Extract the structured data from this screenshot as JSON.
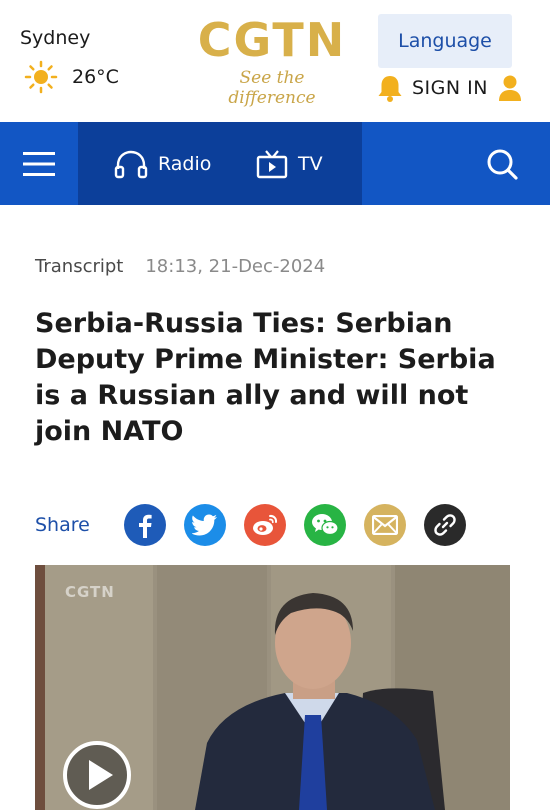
{
  "header": {
    "city": "Sydney",
    "temperature": "26°C",
    "weather_icon": "sun-icon",
    "logo_text": "CGTN",
    "logo_tagline": "See the difference",
    "language_label": "Language",
    "signin_label": "SIGN IN",
    "colors": {
      "gold": "#d8b04a",
      "blue": "#1d4fa8"
    }
  },
  "nav": {
    "menu_icon": "hamburger-menu-icon",
    "radio_label": "Radio",
    "tv_label": "TV",
    "search_icon": "search-icon",
    "colors": {
      "bar": "#1256c4",
      "center": "#0c3f9a"
    }
  },
  "article": {
    "category": "Transcript",
    "timestamp": "18:13, 21-Dec-2024",
    "headline": "Serbia-Russia Ties: Serbian Deputy Prime Minister: Serbia is a Russian ally and will not join NATO"
  },
  "share": {
    "label": "Share",
    "buttons": [
      "facebook-icon",
      "twitter-icon",
      "weibo-icon",
      "wechat-icon",
      "email-icon",
      "link-icon"
    ]
  },
  "video": {
    "watermark": "CGTN",
    "play_icon": "play-icon"
  }
}
